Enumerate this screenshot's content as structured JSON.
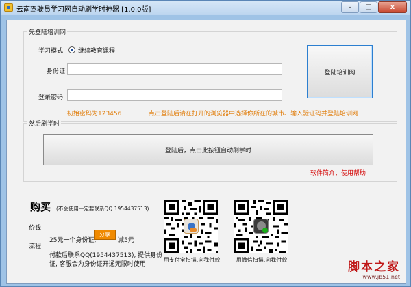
{
  "window": {
    "title": "云南驾驶员学习网自动刷学时神器 [1.0.0版]",
    "controls": {
      "minimize": "–",
      "maximize": "□",
      "close": "x"
    }
  },
  "login_group": {
    "title": "先登陆培训网",
    "study_mode_label": "学习模式",
    "study_mode_option": "继续教育课程",
    "id_label": "身份证",
    "id_value": "",
    "password_label": "登录密码",
    "password_value": "",
    "login_button": "登陆培训网",
    "initial_password_hint": "初始密码为123456",
    "city_hint": "点击登陆后请在打开的浏览器中选择你所在的城市、输入验证码并登陆培训网"
  },
  "study_group": {
    "title": "然后刷学时",
    "start_button": "登陆后，点击此按钮自动刷学时",
    "help_link": "软件简介，使用帮助"
  },
  "purchase": {
    "title": "购买",
    "note": "(不会使用一定要联系QQ:1954437513)",
    "price_label": "价钱:",
    "price_line_prefix": "25元一个身份证,",
    "share_button": "分享",
    "price_line_suffix": "减5元",
    "process_label": "流程:",
    "process_line1": "付款后联系QQ(1954437513), 提供身份",
    "process_line2": "证, 客服会为身份证开通无限时使用"
  },
  "qr_codes": {
    "alipay_caption": "用支付宝扫描,向我付款",
    "wechat_caption": "用微信扫描,向我付款"
  },
  "watermark": {
    "name": "脚本之家",
    "url": "www.jb51.net"
  },
  "colors": {
    "accent_orange": "#e07800",
    "link_red": "#d40000",
    "share_orange": "#f08a00"
  }
}
